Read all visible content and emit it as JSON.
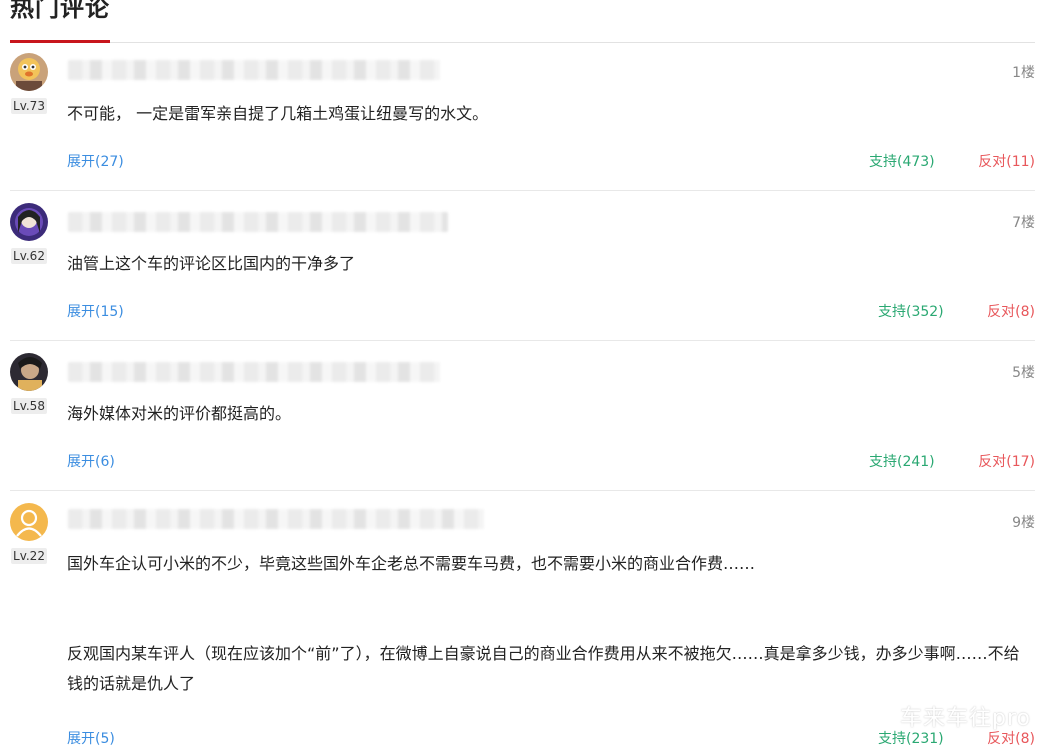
{
  "section": {
    "title": "热门评论"
  },
  "comments": [
    {
      "level": "Lv.73",
      "floor": "1楼",
      "content": "不可能， 一定是雷军亲自提了几箱土鸡蛋让纽曼写的水文。",
      "expand": "展开(27)",
      "support": "支持(473)",
      "oppose": "反对(11)"
    },
    {
      "level": "Lv.62",
      "floor": "7楼",
      "content": "油管上这个车的评论区比国内的干净多了",
      "expand": "展开(15)",
      "support": "支持(352)",
      "oppose": "反对(8)"
    },
    {
      "level": "Lv.58",
      "floor": "5楼",
      "content": "海外媒体对米的评价都挺高的。",
      "expand": "展开(6)",
      "support": "支持(241)",
      "oppose": "反对(17)"
    },
    {
      "level": "Lv.22",
      "floor": "9楼",
      "content": "国外车企认可小米的不少，毕竟这些国外车企老总不需要车马费，也不需要小米的商业合作费……\n\n\n反观国内某车评人（现在应该加个“前”了），在微博上自豪说自己的商业合作费用从来不被拖欠……真是拿多少钱，办多少事啊……不给钱的话就是仇人了",
      "expand": "展开(5)",
      "support": "支持(231)",
      "oppose": "反对(8)"
    }
  ],
  "watermark": "车来车往pro",
  "colors": {
    "accent": "#c8161d",
    "expand": "#3b8de0",
    "support": "#2aa872",
    "oppose": "#e8575b"
  }
}
